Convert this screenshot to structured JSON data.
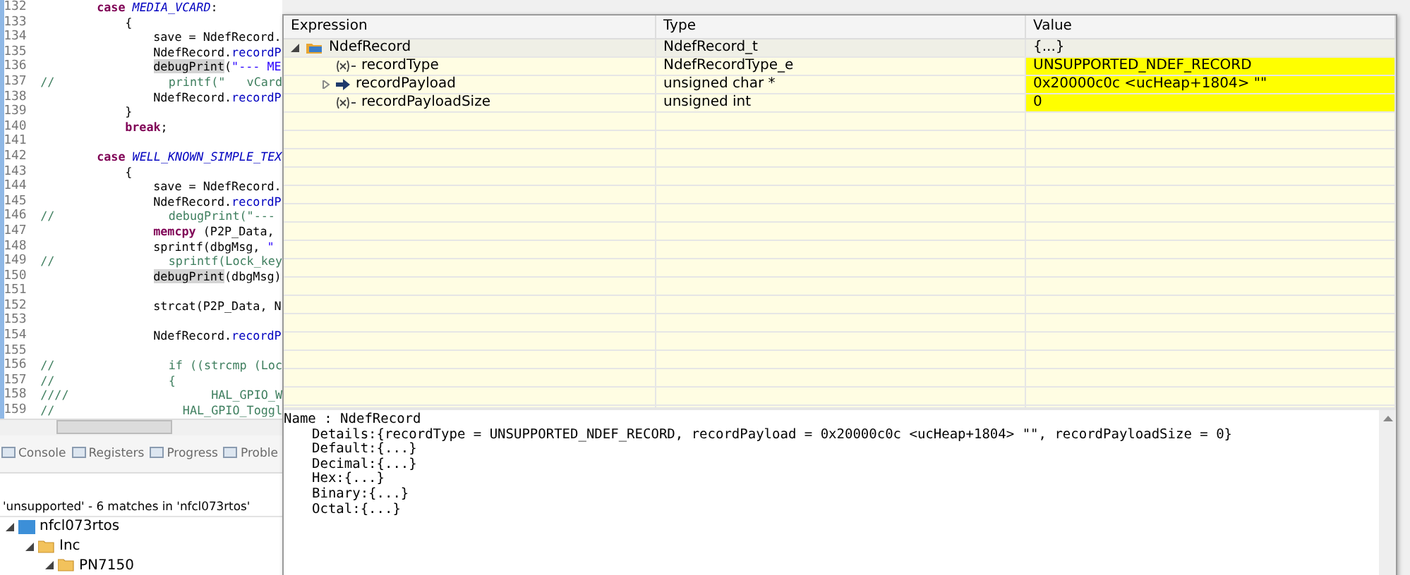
{
  "editor": {
    "lines": [
      {
        "number": "132",
        "kind": "case",
        "segments": [
          {
            "kind": "keyword",
            "text": "case "
          },
          {
            "kind": "constant",
            "text": "MEDIA_VCARD"
          },
          {
            "kind": "plain",
            "text": ":"
          }
        ]
      },
      {
        "number": "133",
        "kind": "block",
        "segments": [
          {
            "kind": "plain",
            "text": "{"
          }
        ]
      },
      {
        "number": "134",
        "kind": "statement",
        "segments": [
          {
            "kind": "plain",
            "text": "save = NdefRecord."
          }
        ]
      },
      {
        "number": "135",
        "kind": "statement",
        "segments": [
          {
            "kind": "plain",
            "text": "NdefRecord."
          },
          {
            "kind": "field",
            "text": "recordP"
          }
        ]
      },
      {
        "number": "136",
        "kind": "statement",
        "segments": [
          {
            "kind": "call",
            "text": "debugPrint"
          },
          {
            "kind": "plain",
            "text": "("
          },
          {
            "kind": "string",
            "text": "\"--- ME"
          }
        ]
      },
      {
        "number": "137",
        "kind": "comment",
        "segments": [
          {
            "kind": "comment",
            "text": "//                printf(\"   vCard"
          }
        ]
      },
      {
        "number": "138",
        "kind": "statement",
        "segments": [
          {
            "kind": "plain",
            "text": "NdefRecord."
          },
          {
            "kind": "field",
            "text": "recordP"
          }
        ]
      },
      {
        "number": "139",
        "kind": "block",
        "segments": [
          {
            "kind": "plain",
            "text": "}"
          }
        ]
      },
      {
        "number": "140",
        "kind": "block",
        "segments": [
          {
            "kind": "keyword",
            "text": "break"
          },
          {
            "kind": "plain",
            "text": ";"
          }
        ]
      },
      {
        "number": "141"
      },
      {
        "number": "142",
        "kind": "case",
        "segments": [
          {
            "kind": "keyword",
            "text": "case "
          },
          {
            "kind": "constant",
            "text": "WELL_KNOWN_SIMPLE_TEX"
          }
        ]
      },
      {
        "number": "143",
        "kind": "block",
        "segments": [
          {
            "kind": "plain",
            "text": "{"
          }
        ]
      },
      {
        "number": "144",
        "kind": "statement",
        "segments": [
          {
            "kind": "plain",
            "text": "save = NdefRecord."
          }
        ]
      },
      {
        "number": "145",
        "kind": "statement",
        "segments": [
          {
            "kind": "plain",
            "text": "NdefRecord."
          },
          {
            "kind": "field",
            "text": "recordP"
          }
        ]
      },
      {
        "number": "146",
        "kind": "comment",
        "segments": [
          {
            "kind": "comment",
            "text": "//                debugPrint(\"---"
          }
        ]
      },
      {
        "number": "147",
        "kind": "statement",
        "segments": [
          {
            "kind": "keyword",
            "text": "memcpy"
          },
          {
            "kind": "plain",
            "text": " (P2P_Data,"
          }
        ]
      },
      {
        "number": "148",
        "kind": "statement",
        "segments": [
          {
            "kind": "plain",
            "text": "sprintf(dbgMsg, "
          },
          {
            "kind": "string",
            "text": "\""
          }
        ]
      },
      {
        "number": "149",
        "kind": "comment",
        "segments": [
          {
            "kind": "comment",
            "text": "//                sprintf(Lock_key"
          }
        ]
      },
      {
        "number": "150",
        "kind": "statement",
        "segments": [
          {
            "kind": "call",
            "text": "debugPrint"
          },
          {
            "kind": "plain",
            "text": "(dbgMsg)"
          }
        ]
      },
      {
        "number": "151"
      },
      {
        "number": "152",
        "kind": "statement",
        "segments": [
          {
            "kind": "plain",
            "text": "strcat(P2P_Data, N"
          }
        ]
      },
      {
        "number": "153"
      },
      {
        "number": "154",
        "kind": "statement",
        "segments": [
          {
            "kind": "plain",
            "text": "NdefRecord."
          },
          {
            "kind": "field",
            "text": "recordP"
          }
        ]
      },
      {
        "number": "155"
      },
      {
        "number": "156",
        "kind": "comment",
        "segments": [
          {
            "kind": "comment",
            "text": "//                if ((strcmp (Loc"
          }
        ]
      },
      {
        "number": "157",
        "kind": "comment",
        "segments": [
          {
            "kind": "comment",
            "text": "//                {"
          }
        ]
      },
      {
        "number": "158",
        "kind": "comment",
        "segments": [
          {
            "kind": "comment",
            "text": "////                    HAL_GPIO_W"
          }
        ]
      },
      {
        "number": "159",
        "kind": "comment",
        "segments": [
          {
            "kind": "comment",
            "text": "//                  HAL_GPIO_Toggl"
          }
        ]
      }
    ]
  },
  "bottom_tabs": [
    {
      "label": "Console",
      "selected": false
    },
    {
      "label": "Registers",
      "selected": false
    },
    {
      "label": "Progress",
      "selected": false
    },
    {
      "label": "Proble",
      "selected": false
    }
  ],
  "search": {
    "summary": "'unsupported' - 6 matches in 'nfcl073rtos'",
    "tree": [
      {
        "label": "nfcl073rtos",
        "kind": "project",
        "expanded": true,
        "children": [
          {
            "label": "Inc",
            "kind": "folder",
            "expanded": true,
            "children": [
              {
                "label": "PN7150",
                "kind": "folder",
                "expanded": true
              }
            ]
          }
        ]
      }
    ]
  },
  "expressions": {
    "columns": [
      "Expression",
      "Type",
      "Value"
    ],
    "rows": [
      {
        "name": "NdefRecord",
        "type": "NdefRecord_t",
        "value": "{...}",
        "kind": "struct",
        "expanded": true,
        "selected": true,
        "changed": false,
        "children": [
          {
            "name": "recordType",
            "type": "NdefRecordType_e",
            "value": "UNSUPPORTED_NDEF_RECORD",
            "kind": "variable",
            "changed": true,
            "selected": false
          },
          {
            "name": "recordPayload",
            "type": "unsigned char *",
            "value": "0x20000c0c <ucHeap+1804> \"\"",
            "kind": "pointer",
            "expanded": false,
            "changed": true,
            "selected": false
          },
          {
            "name": "recordPayloadSize",
            "type": "unsigned int",
            "value": "0",
            "kind": "variable",
            "changed": true,
            "selected": false
          }
        ]
      }
    ],
    "details": [
      "Name : NdefRecord",
      "Details:{recordType = UNSUPPORTED_NDEF_RECORD, recordPayload = 0x20000c0c <ucHeap+1804> \"\", recordPayloadSize = 0}",
      "Default:{...}",
      "Decimal:{...}",
      "Hex:{...}",
      "Binary:{...}",
      "Octal:{...}"
    ]
  }
}
